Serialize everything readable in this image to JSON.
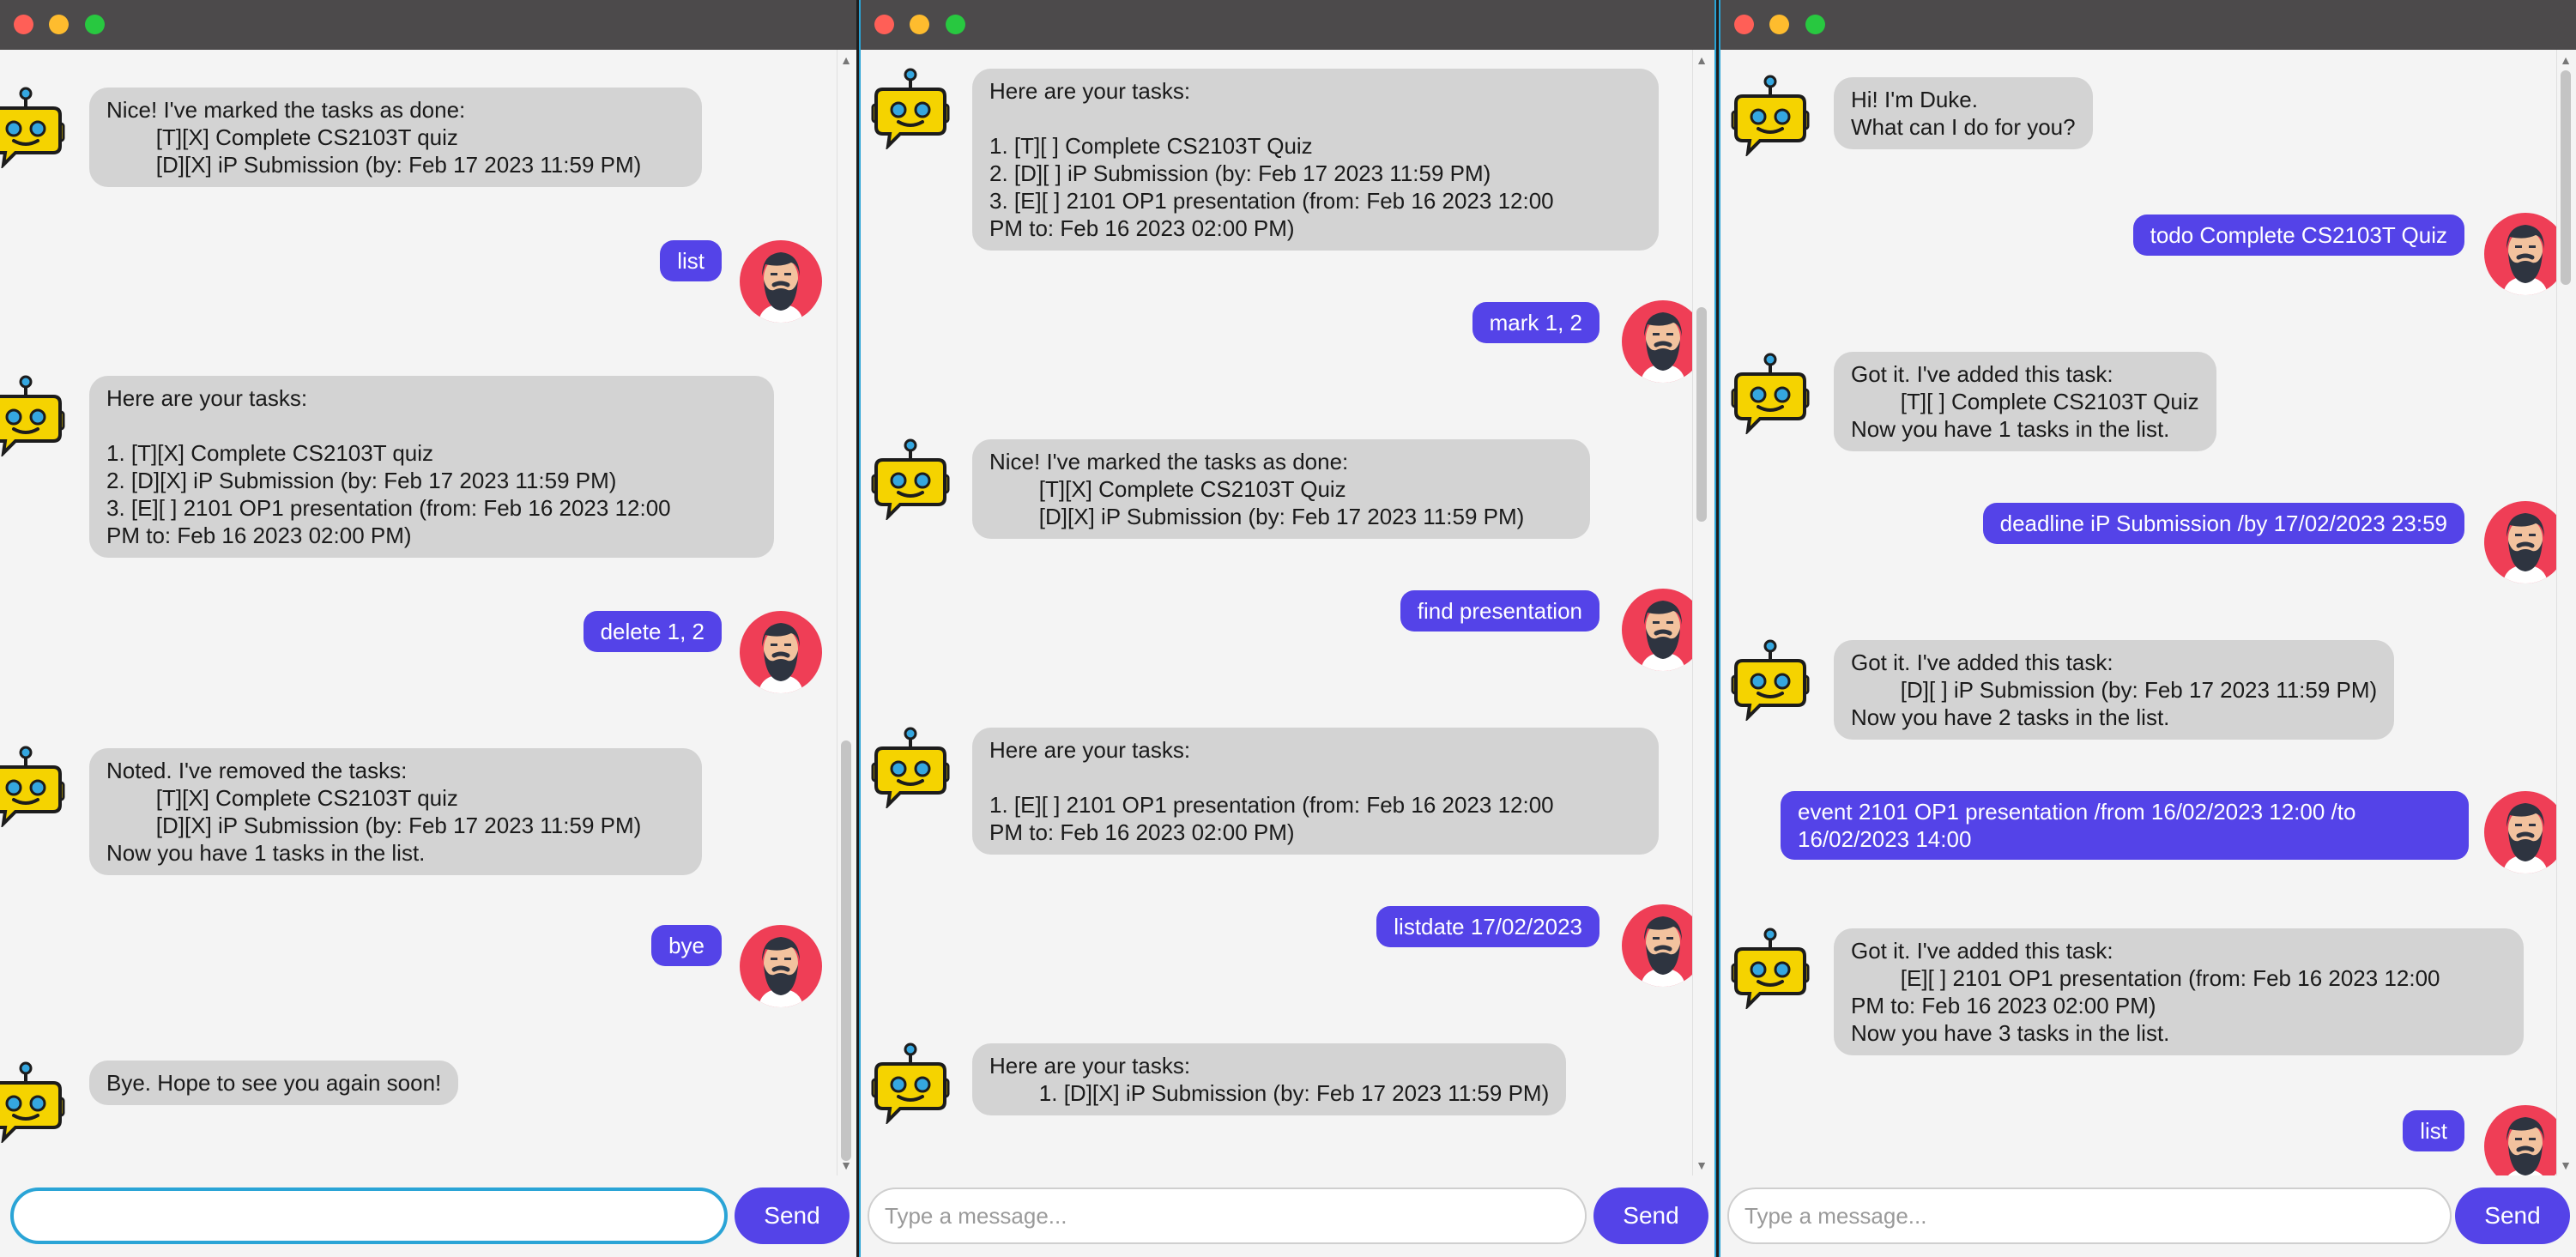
{
  "windows": [
    {
      "input_value": "",
      "input_placeholder": "",
      "send_label": "Send",
      "messages": [
        {
          "from": "duke",
          "text": "Nice! I've marked the tasks as done:\n        [T][X] Complete CS2103T quiz\n        [D][X] iP Submission (by: Feb 17 2023 11:59 PM)"
        },
        {
          "from": "user",
          "text": "list"
        },
        {
          "from": "duke",
          "text": "Here are your tasks:\n\n1. [T][X] Complete CS2103T quiz\n2. [D][X] iP Submission (by: Feb 17 2023 11:59 PM)\n3. [E][ ] 2101 OP1 presentation (from: Feb 16 2023 12:00\nPM to: Feb 16 2023 02:00 PM)"
        },
        {
          "from": "user",
          "text": "delete 1, 2"
        },
        {
          "from": "duke",
          "text": "Noted. I've removed the tasks:\n        [T][X] Complete CS2103T quiz\n        [D][X] iP Submission (by: Feb 17 2023 11:59 PM)\nNow you have 1 tasks in the list."
        },
        {
          "from": "user",
          "text": "bye"
        },
        {
          "from": "duke",
          "text": "Bye. Hope to see you again soon!"
        }
      ]
    },
    {
      "input_value": "",
      "input_placeholder": "Type a message...",
      "send_label": "Send",
      "messages": [
        {
          "from": "duke",
          "text": "Here are your tasks:\n\n1. [T][ ] Complete CS2103T Quiz\n2. [D][ ] iP Submission (by: Feb 17 2023 11:59 PM)\n3. [E][ ] 2101 OP1 presentation (from: Feb 16 2023 12:00\nPM to: Feb 16 2023 02:00 PM)"
        },
        {
          "from": "user",
          "text": "mark 1, 2"
        },
        {
          "from": "duke",
          "text": "Nice! I've marked the tasks as done:\n        [T][X] Complete CS2103T Quiz\n        [D][X] iP Submission (by: Feb 17 2023 11:59 PM)"
        },
        {
          "from": "user",
          "text": "find presentation"
        },
        {
          "from": "duke",
          "text": "Here are your tasks:\n\n1. [E][ ] 2101 OP1 presentation (from: Feb 16 2023 12:00\nPM to: Feb 16 2023 02:00 PM)"
        },
        {
          "from": "user",
          "text": "listdate 17/02/2023"
        },
        {
          "from": "duke",
          "text": "Here are your tasks:\n        1. [D][X] iP Submission (by: Feb 17 2023 11:59 PM)"
        }
      ]
    },
    {
      "input_value": "",
      "input_placeholder": "Type a message...",
      "send_label": "Send",
      "messages": [
        {
          "from": "duke",
          "text": "Hi! I'm Duke.\nWhat can I do for you?"
        },
        {
          "from": "user",
          "text": "todo Complete CS2103T Quiz"
        },
        {
          "from": "duke",
          "text": "Got it. I've added this task:\n        [T][ ] Complete CS2103T Quiz\nNow you have 1 tasks in the list."
        },
        {
          "from": "user",
          "text": "deadline iP Submission /by 17/02/2023 23:59"
        },
        {
          "from": "duke",
          "text": "Got it. I've added this task:\n        [D][ ] iP Submission (by: Feb 17 2023 11:59 PM)\nNow you have 2 tasks in the list."
        },
        {
          "from": "user",
          "text": "event 2101 OP1 presentation /from 16/02/2023 12:00 /to\n16/02/2023 14:00"
        },
        {
          "from": "duke",
          "text": "Got it. I've added this task:\n        [E][ ] 2101 OP1 presentation (from: Feb 16 2023 12:00\nPM to: Feb 16 2023 02:00 PM)\nNow you have 3 tasks in the list."
        },
        {
          "from": "user",
          "text": "list"
        }
      ]
    }
  ],
  "colors": {
    "user_bubble": "#5443e8",
    "duke_bubble": "#d3d3d3",
    "send_button": "#5443e8",
    "titlebar": "#4c4a4b",
    "focus_ring": "#2aa4d6"
  }
}
